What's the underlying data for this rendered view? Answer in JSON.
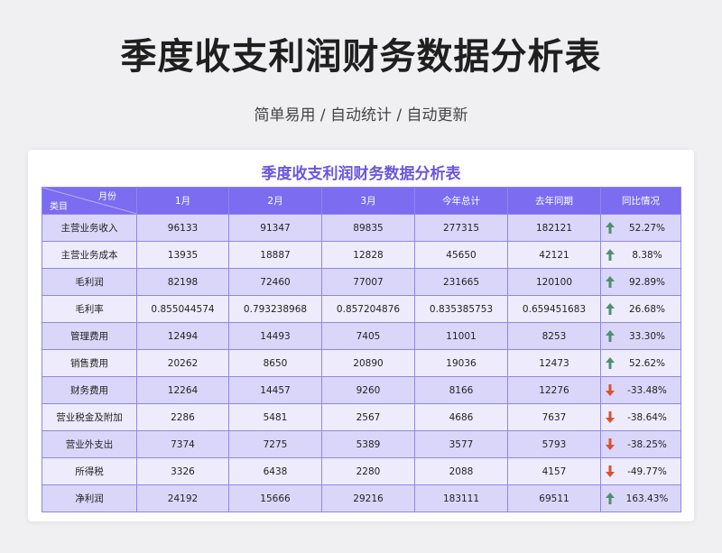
{
  "page": {
    "title": "季度收支利润财务数据分析表",
    "subtitle": "简单易用 / 自动统计 / 自动更新"
  },
  "table": {
    "title": "季度收支利润财务数据分析表",
    "corner_top": "月份",
    "corner_bottom": "类目",
    "columns": [
      "1月",
      "2月",
      "3月",
      "今年总计",
      "去年同期",
      "同比情况"
    ],
    "rows": [
      {
        "label": "主营业务收入",
        "values": [
          "96133",
          "91347",
          "89835",
          "277315",
          "182121"
        ],
        "yoy": "52.27%",
        "trend": "up"
      },
      {
        "label": "主营业务成本",
        "values": [
          "13935",
          "18887",
          "12828",
          "45650",
          "42121"
        ],
        "yoy": "8.38%",
        "trend": "up"
      },
      {
        "label": "毛利润",
        "values": [
          "82198",
          "72460",
          "77007",
          "231665",
          "120100"
        ],
        "yoy": "92.89%",
        "trend": "up"
      },
      {
        "label": "毛利率",
        "values": [
          "0.855044574",
          "0.793238968",
          "0.857204876",
          "0.835385753",
          "0.659451683"
        ],
        "yoy": "26.68%",
        "trend": "up"
      },
      {
        "label": "管理费用",
        "values": [
          "12494",
          "14493",
          "7405",
          "11001",
          "8253"
        ],
        "yoy": "33.30%",
        "trend": "up"
      },
      {
        "label": "销售费用",
        "values": [
          "20262",
          "8650",
          "20890",
          "19036",
          "12473"
        ],
        "yoy": "52.62%",
        "trend": "up"
      },
      {
        "label": "财务费用",
        "values": [
          "12264",
          "14457",
          "9260",
          "8166",
          "12276"
        ],
        "yoy": "-33.48%",
        "trend": "down"
      },
      {
        "label": "营业税金及附加",
        "values": [
          "2286",
          "5481",
          "2567",
          "4686",
          "7637"
        ],
        "yoy": "-38.64%",
        "trend": "down"
      },
      {
        "label": "营业外支出",
        "values": [
          "7374",
          "7275",
          "5389",
          "3577",
          "5793"
        ],
        "yoy": "-38.25%",
        "trend": "down"
      },
      {
        "label": "所得税",
        "values": [
          "3326",
          "6438",
          "2280",
          "2088",
          "4157"
        ],
        "yoy": "-49.77%",
        "trend": "down"
      },
      {
        "label": "净利润",
        "values": [
          "24192",
          "15666",
          "29216",
          "183111",
          "69511"
        ],
        "yoy": "163.43%",
        "trend": "up"
      }
    ]
  },
  "colors": {
    "header_bg": "#7b6cf0",
    "row_odd": "#dad6fa",
    "row_even": "#eeecfc",
    "title_accent": "#6a56e0",
    "up_arrow": "#4e8f72",
    "down_arrow": "#d6532f"
  },
  "icons": {
    "up": "arrow-up-icon",
    "down": "arrow-down-icon"
  }
}
